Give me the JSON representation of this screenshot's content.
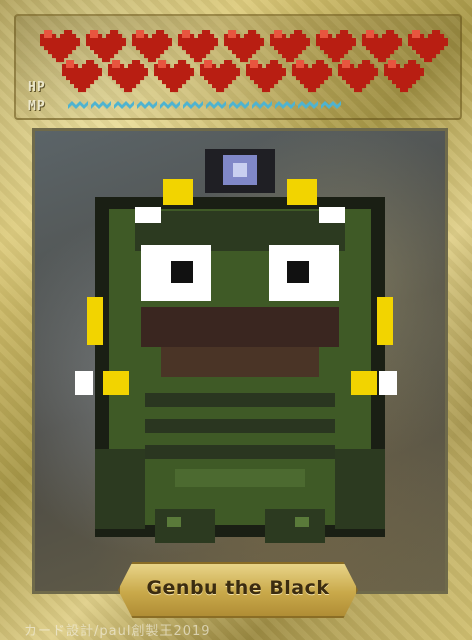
{
  "card": {
    "name": "Genbu the Black",
    "credit": "カード設計/paul創製王2019"
  },
  "stats": {
    "hp_label": "HP",
    "mp_label": "MP",
    "hp_hearts": 17,
    "mp_pips": 12,
    "heart_color": "#b81e12",
    "mp_color": "#4fb3d0"
  },
  "portrait": {
    "subject": "Genbu turtle-frog pixel sprite",
    "eye_color": "#ffffff",
    "accent_color": "#f2d400",
    "body_color": "#3f5a26"
  }
}
